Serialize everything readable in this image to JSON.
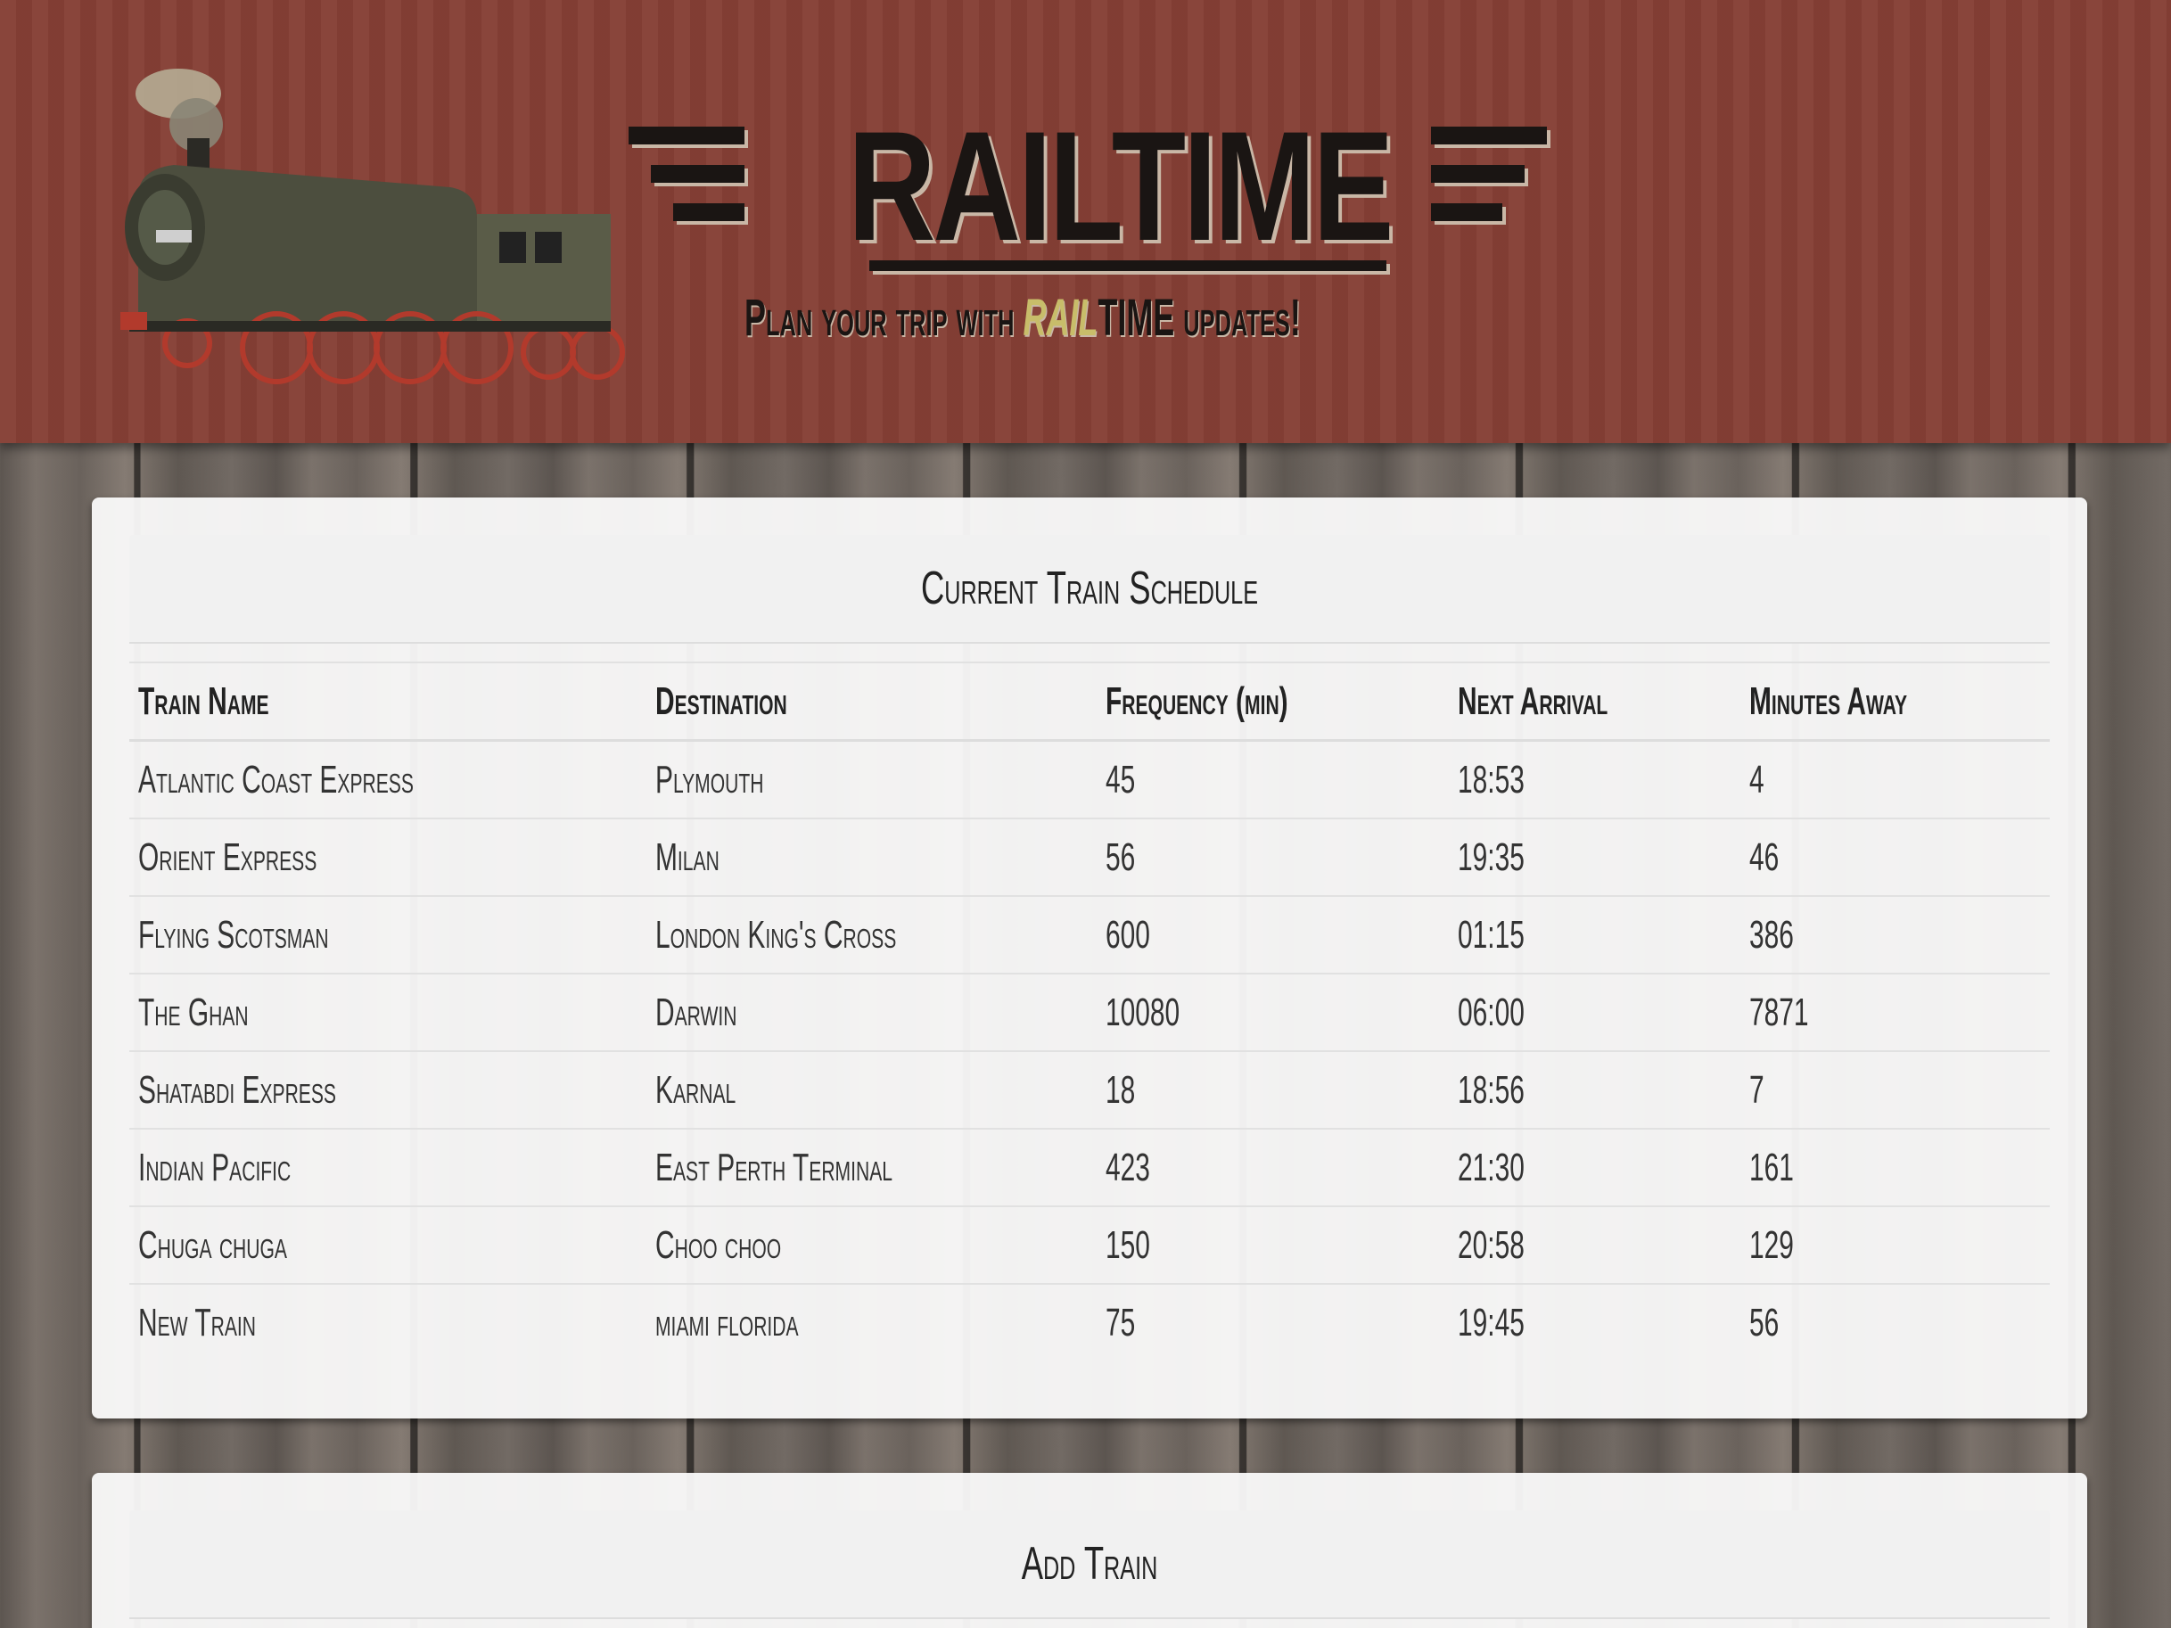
{
  "header": {
    "logo_text": "RAILTIME",
    "tagline_prefix": "Plan your trip with ",
    "tagline_brand": "RAIL",
    "tagline_suffix": "TIME updates!",
    "background_color": "#853f35",
    "brand_accent_color": "#c8bd6a"
  },
  "schedule": {
    "title": "Current Train Schedule",
    "columns": [
      "Train Name",
      "Destination",
      "Frequency (min)",
      "Next Arrival",
      "Minutes Away"
    ],
    "rows": [
      [
        "Atlantic Coast Express",
        "Plymouth",
        "45",
        "18:53",
        "4"
      ],
      [
        "Orient Express",
        "Milan",
        "56",
        "19:35",
        "46"
      ],
      [
        "Flying Scotsman",
        "London King's Cross",
        "600",
        "01:15",
        "386"
      ],
      [
        "The Ghan",
        "Darwin",
        "10080",
        "06:00",
        "7871"
      ],
      [
        "Shatabdi Express",
        "Karnal",
        "18",
        "18:56",
        "7"
      ],
      [
        "Indian Pacific",
        "East Perth Terminal",
        "423",
        "21:30",
        "161"
      ],
      [
        "Chuga chuga",
        "Choo choo",
        "150",
        "20:58",
        "129"
      ],
      [
        "New Train",
        "miami florida",
        "75",
        "19:45",
        "56"
      ]
    ]
  },
  "add_train": {
    "title": "Add Train"
  }
}
